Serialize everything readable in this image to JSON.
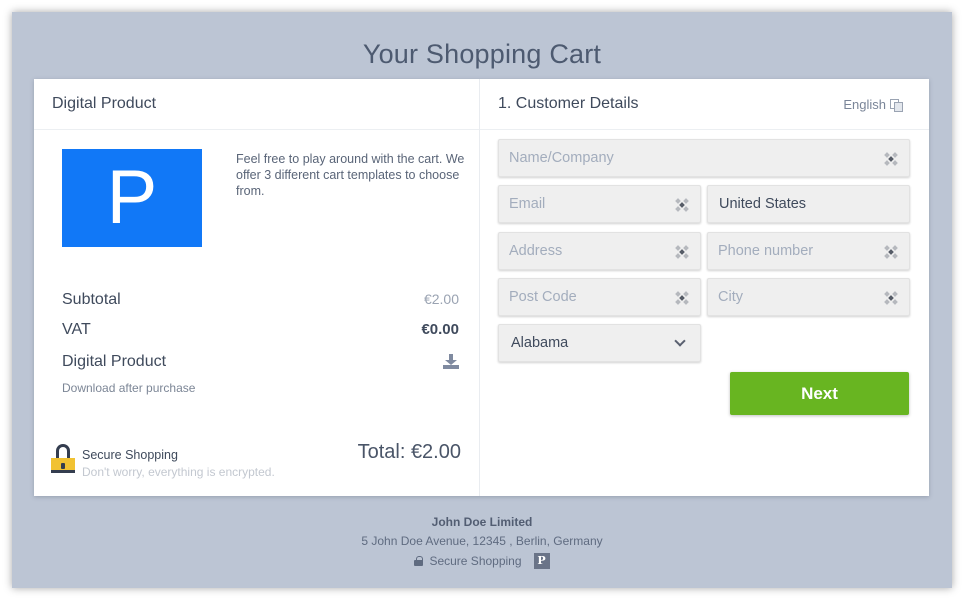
{
  "page": {
    "title": "Your Shopping Cart"
  },
  "left": {
    "header": "Digital Product",
    "product_logo_letter": "P",
    "product_description": "Feel free to play around with the cart. We offer 3 different cart templates to choose from.",
    "subtotal_label": "Subtotal",
    "subtotal_value": "€2.00",
    "vat_label": "VAT",
    "vat_value": "€0.00",
    "digital_label": "Digital Product",
    "digital_note": "Download after purchase",
    "secure_title": "Secure Shopping",
    "secure_subtitle": "Don't worry, everything is encrypted.",
    "total": "Total: €2.00"
  },
  "right": {
    "header": "1. Customer Details",
    "language": "English",
    "fields": {
      "name": {
        "placeholder": "Name/Company"
      },
      "email": {
        "placeholder": "Email"
      },
      "country": {
        "value": "United States"
      },
      "address": {
        "placeholder": "Address"
      },
      "phone": {
        "placeholder": "Phone number"
      },
      "postcode": {
        "placeholder": "Post Code"
      },
      "city": {
        "placeholder": "City"
      },
      "state": {
        "value": "Alabama"
      }
    },
    "next_label": "Next"
  },
  "footer": {
    "company": "John Doe Limited",
    "address": "5 John Doe Avenue, 12345 , Berlin, Germany",
    "secure": "Secure Shopping",
    "badge": "P"
  },
  "colors": {
    "background": "#bcc5d4",
    "product_logo": "#1178f7",
    "next_button": "#68b521",
    "lock_body": "#f1c232"
  }
}
